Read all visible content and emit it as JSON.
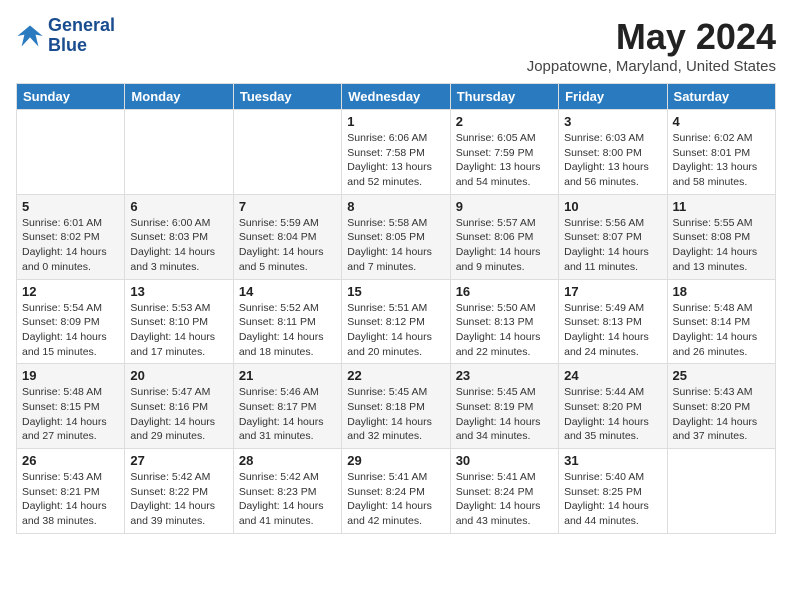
{
  "header": {
    "logo_line1": "General",
    "logo_line2": "Blue",
    "month_title": "May 2024",
    "location": "Joppatowne, Maryland, United States"
  },
  "weekdays": [
    "Sunday",
    "Monday",
    "Tuesday",
    "Wednesday",
    "Thursday",
    "Friday",
    "Saturday"
  ],
  "weeks": [
    [
      {
        "day": "",
        "info": ""
      },
      {
        "day": "",
        "info": ""
      },
      {
        "day": "",
        "info": ""
      },
      {
        "day": "1",
        "info": "Sunrise: 6:06 AM\nSunset: 7:58 PM\nDaylight: 13 hours and 52 minutes."
      },
      {
        "day": "2",
        "info": "Sunrise: 6:05 AM\nSunset: 7:59 PM\nDaylight: 13 hours and 54 minutes."
      },
      {
        "day": "3",
        "info": "Sunrise: 6:03 AM\nSunset: 8:00 PM\nDaylight: 13 hours and 56 minutes."
      },
      {
        "day": "4",
        "info": "Sunrise: 6:02 AM\nSunset: 8:01 PM\nDaylight: 13 hours and 58 minutes."
      }
    ],
    [
      {
        "day": "5",
        "info": "Sunrise: 6:01 AM\nSunset: 8:02 PM\nDaylight: 14 hours and 0 minutes."
      },
      {
        "day": "6",
        "info": "Sunrise: 6:00 AM\nSunset: 8:03 PM\nDaylight: 14 hours and 3 minutes."
      },
      {
        "day": "7",
        "info": "Sunrise: 5:59 AM\nSunset: 8:04 PM\nDaylight: 14 hours and 5 minutes."
      },
      {
        "day": "8",
        "info": "Sunrise: 5:58 AM\nSunset: 8:05 PM\nDaylight: 14 hours and 7 minutes."
      },
      {
        "day": "9",
        "info": "Sunrise: 5:57 AM\nSunset: 8:06 PM\nDaylight: 14 hours and 9 minutes."
      },
      {
        "day": "10",
        "info": "Sunrise: 5:56 AM\nSunset: 8:07 PM\nDaylight: 14 hours and 11 minutes."
      },
      {
        "day": "11",
        "info": "Sunrise: 5:55 AM\nSunset: 8:08 PM\nDaylight: 14 hours and 13 minutes."
      }
    ],
    [
      {
        "day": "12",
        "info": "Sunrise: 5:54 AM\nSunset: 8:09 PM\nDaylight: 14 hours and 15 minutes."
      },
      {
        "day": "13",
        "info": "Sunrise: 5:53 AM\nSunset: 8:10 PM\nDaylight: 14 hours and 17 minutes."
      },
      {
        "day": "14",
        "info": "Sunrise: 5:52 AM\nSunset: 8:11 PM\nDaylight: 14 hours and 18 minutes."
      },
      {
        "day": "15",
        "info": "Sunrise: 5:51 AM\nSunset: 8:12 PM\nDaylight: 14 hours and 20 minutes."
      },
      {
        "day": "16",
        "info": "Sunrise: 5:50 AM\nSunset: 8:13 PM\nDaylight: 14 hours and 22 minutes."
      },
      {
        "day": "17",
        "info": "Sunrise: 5:49 AM\nSunset: 8:13 PM\nDaylight: 14 hours and 24 minutes."
      },
      {
        "day": "18",
        "info": "Sunrise: 5:48 AM\nSunset: 8:14 PM\nDaylight: 14 hours and 26 minutes."
      }
    ],
    [
      {
        "day": "19",
        "info": "Sunrise: 5:48 AM\nSunset: 8:15 PM\nDaylight: 14 hours and 27 minutes."
      },
      {
        "day": "20",
        "info": "Sunrise: 5:47 AM\nSunset: 8:16 PM\nDaylight: 14 hours and 29 minutes."
      },
      {
        "day": "21",
        "info": "Sunrise: 5:46 AM\nSunset: 8:17 PM\nDaylight: 14 hours and 31 minutes."
      },
      {
        "day": "22",
        "info": "Sunrise: 5:45 AM\nSunset: 8:18 PM\nDaylight: 14 hours and 32 minutes."
      },
      {
        "day": "23",
        "info": "Sunrise: 5:45 AM\nSunset: 8:19 PM\nDaylight: 14 hours and 34 minutes."
      },
      {
        "day": "24",
        "info": "Sunrise: 5:44 AM\nSunset: 8:20 PM\nDaylight: 14 hours and 35 minutes."
      },
      {
        "day": "25",
        "info": "Sunrise: 5:43 AM\nSunset: 8:20 PM\nDaylight: 14 hours and 37 minutes."
      }
    ],
    [
      {
        "day": "26",
        "info": "Sunrise: 5:43 AM\nSunset: 8:21 PM\nDaylight: 14 hours and 38 minutes."
      },
      {
        "day": "27",
        "info": "Sunrise: 5:42 AM\nSunset: 8:22 PM\nDaylight: 14 hours and 39 minutes."
      },
      {
        "day": "28",
        "info": "Sunrise: 5:42 AM\nSunset: 8:23 PM\nDaylight: 14 hours and 41 minutes."
      },
      {
        "day": "29",
        "info": "Sunrise: 5:41 AM\nSunset: 8:24 PM\nDaylight: 14 hours and 42 minutes."
      },
      {
        "day": "30",
        "info": "Sunrise: 5:41 AM\nSunset: 8:24 PM\nDaylight: 14 hours and 43 minutes."
      },
      {
        "day": "31",
        "info": "Sunrise: 5:40 AM\nSunset: 8:25 PM\nDaylight: 14 hours and 44 minutes."
      },
      {
        "day": "",
        "info": ""
      }
    ]
  ]
}
